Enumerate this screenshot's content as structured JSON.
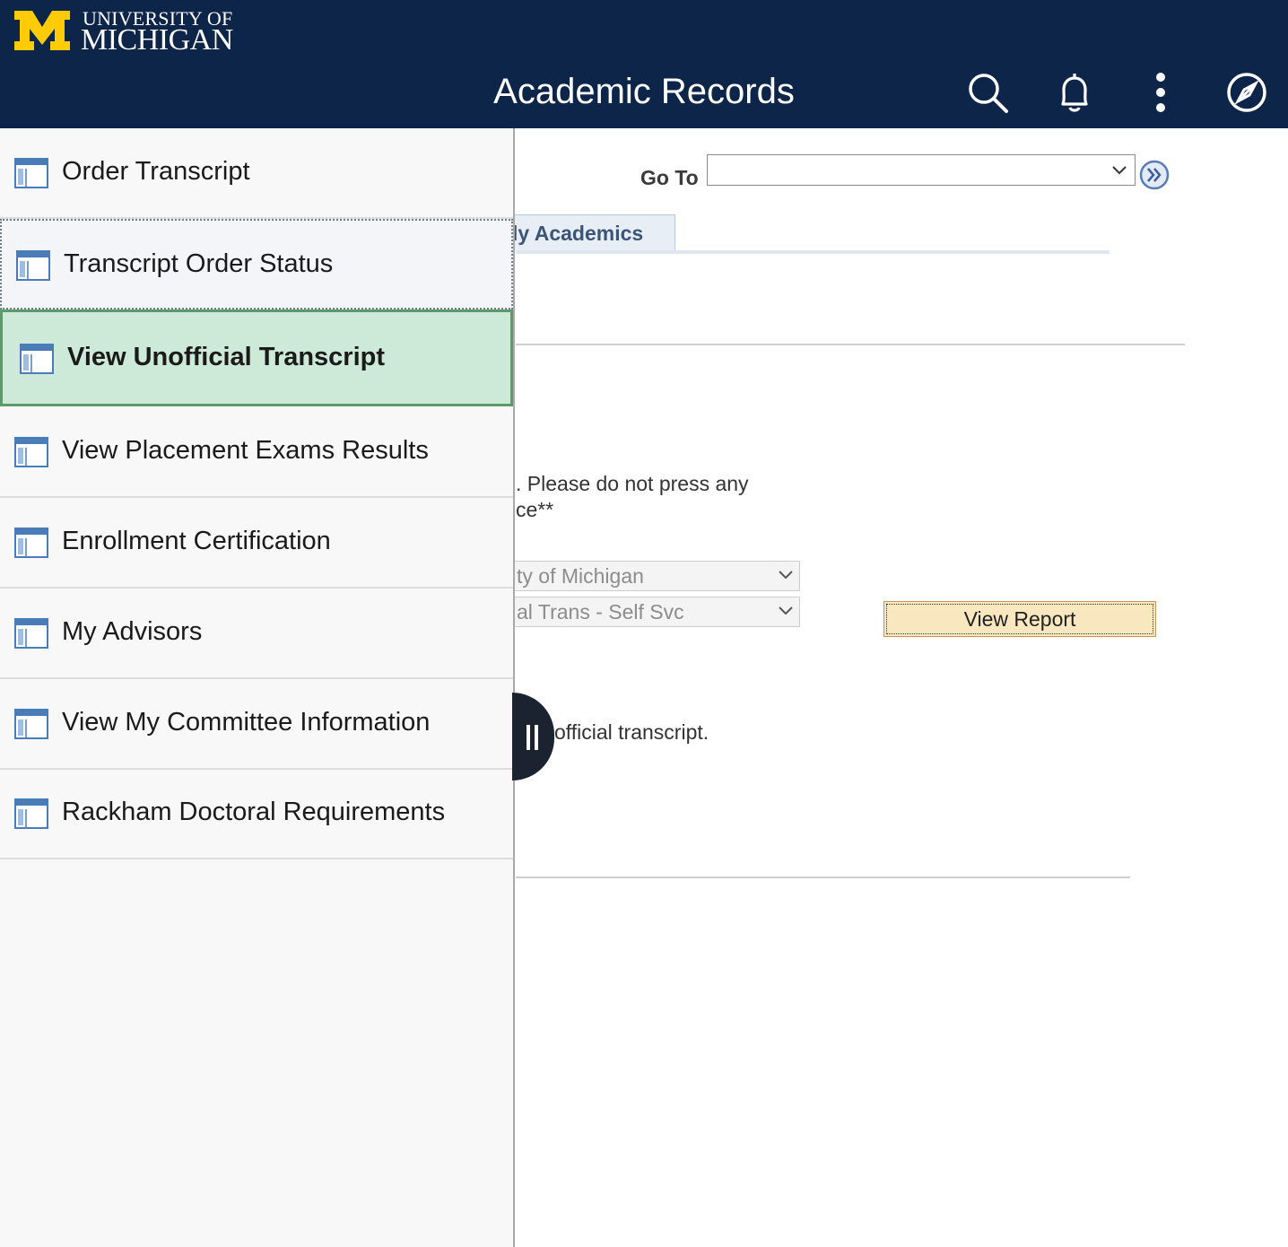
{
  "header": {
    "logo_line1": "UNIVERSITY OF",
    "logo_line2": "MICHIGAN",
    "title": "Academic Records",
    "colors": {
      "background": "#0c2548",
      "logo_maize": "#ffcb05"
    },
    "icons": [
      "search-icon",
      "bell-icon",
      "more-vertical-icon",
      "compass-icon"
    ]
  },
  "content": {
    "goto_label": "Go To",
    "goto_value": "",
    "tab_label": "ly Academics",
    "message_line1": ". Please do not press any",
    "message_line2": "ce**",
    "institution_select": "ty of Michigan",
    "report_select": "al Trans - Self Svc",
    "view_report_label": "View Report",
    "footer_message": "official transcript."
  },
  "sidebar": {
    "items": [
      {
        "label": "Order Transcript",
        "state": "default"
      },
      {
        "label": "Transcript Order Status",
        "state": "focused"
      },
      {
        "label": "View Unofficial Transcript",
        "state": "active"
      },
      {
        "label": "View Placement Exams Results",
        "state": "default"
      },
      {
        "label": "Enrollment Certification",
        "state": "default"
      },
      {
        "label": "My Advisors",
        "state": "default"
      },
      {
        "label": "View My Committee Information",
        "state": "default"
      },
      {
        "label": "Rackham Doctoral Requirements",
        "state": "default"
      }
    ],
    "active_color": "#cde9d8",
    "active_border": "#5c9a6b"
  }
}
